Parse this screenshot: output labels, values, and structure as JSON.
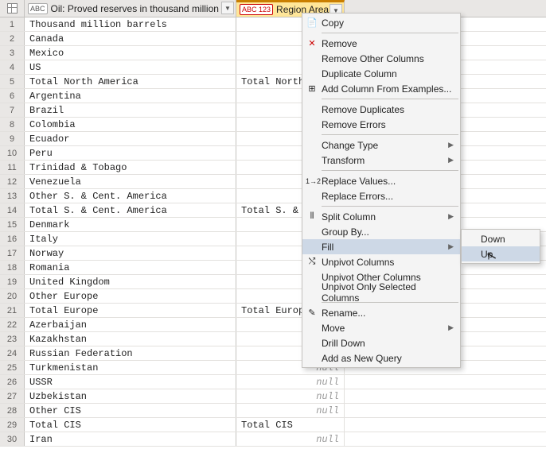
{
  "columns": {
    "col1_type": "ABC",
    "col1_name": "Oil: Proved reserves in thousand million barrels",
    "col2_type": "ABC 123",
    "col2_name": "Region Area"
  },
  "null_text": "null",
  "rows": [
    {
      "i": "1",
      "a": "Thousand million barrels",
      "b": ""
    },
    {
      "i": "2",
      "a": "Canada",
      "b": "",
      "null": true
    },
    {
      "i": "3",
      "a": "Mexico",
      "b": "",
      "null": true
    },
    {
      "i": "4",
      "a": "US",
      "b": "",
      "null": true
    },
    {
      "i": "5",
      "a": "Total North America",
      "b": "Total North"
    },
    {
      "i": "6",
      "a": "Argentina",
      "b": "",
      "null": true
    },
    {
      "i": "7",
      "a": "Brazil",
      "b": "",
      "null": true
    },
    {
      "i": "8",
      "a": "Colombia",
      "b": "",
      "null": true
    },
    {
      "i": "9",
      "a": "Ecuador",
      "b": "",
      "null": true
    },
    {
      "i": "10",
      "a": "Peru",
      "b": "",
      "null": true
    },
    {
      "i": "11",
      "a": "Trinidad & Tobago",
      "b": "",
      "null": true
    },
    {
      "i": "12",
      "a": "Venezuela",
      "b": "",
      "null": true
    },
    {
      "i": "13",
      "a": "Other S. & Cent. America",
      "b": "",
      "null": true
    },
    {
      "i": "14",
      "a": "Total S. & Cent. America",
      "b": "Total S. & C"
    },
    {
      "i": "15",
      "a": "Denmark",
      "b": "",
      "null": true
    },
    {
      "i": "16",
      "a": "Italy",
      "b": "",
      "null": true
    },
    {
      "i": "17",
      "a": "Norway",
      "b": "",
      "null": true
    },
    {
      "i": "18",
      "a": "Romania",
      "b": "",
      "null": true
    },
    {
      "i": "19",
      "a": "United Kingdom",
      "b": "",
      "null": true
    },
    {
      "i": "20",
      "a": "Other Europe",
      "b": "",
      "null": true
    },
    {
      "i": "21",
      "a": "Total Europe",
      "b": "Total Europe"
    },
    {
      "i": "22",
      "a": "Azerbaijan",
      "b": "",
      "null": true
    },
    {
      "i": "23",
      "a": "Kazakhstan",
      "b": "",
      "null": true
    },
    {
      "i": "24",
      "a": "Russian Federation",
      "b": "",
      "null": true
    },
    {
      "i": "25",
      "a": "Turkmenistan",
      "b": "null",
      "null": true
    },
    {
      "i": "26",
      "a": "USSR",
      "b": "null",
      "null": true
    },
    {
      "i": "27",
      "a": "Uzbekistan",
      "b": "null",
      "null": true
    },
    {
      "i": "28",
      "a": "Other CIS",
      "b": "null",
      "null": true
    },
    {
      "i": "29",
      "a": "Total CIS",
      "b": "Total CIS"
    },
    {
      "i": "30",
      "a": "Iran",
      "b": "null",
      "null": true
    }
  ],
  "menu": {
    "copy": "Copy",
    "remove": "Remove",
    "remove_other": "Remove Other Columns",
    "duplicate": "Duplicate Column",
    "add_from_examples": "Add Column From Examples...",
    "remove_dup": "Remove Duplicates",
    "remove_err": "Remove Errors",
    "change_type": "Change Type",
    "transform": "Transform",
    "replace_values": "Replace Values...",
    "replace_errors": "Replace Errors...",
    "split": "Split Column",
    "groupby": "Group By...",
    "fill": "Fill",
    "unpivot": "Unpivot Columns",
    "unpivot_other": "Unpivot Other Columns",
    "unpivot_sel": "Unpivot Only Selected Columns",
    "rename": "Rename...",
    "move": "Move",
    "drill": "Drill Down",
    "add_query": "Add as New Query"
  },
  "submenu": {
    "down": "Down",
    "up": "Up"
  }
}
